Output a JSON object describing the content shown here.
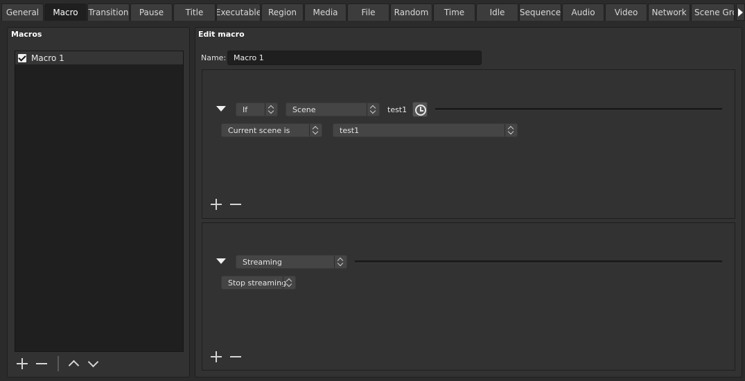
{
  "tabs": [
    {
      "label": "General"
    },
    {
      "label": "Macro",
      "active": true
    },
    {
      "label": "Transition"
    },
    {
      "label": "Pause"
    },
    {
      "label": "Title"
    },
    {
      "label": "Executable"
    },
    {
      "label": "Region"
    },
    {
      "label": "Media"
    },
    {
      "label": "File"
    },
    {
      "label": "Random"
    },
    {
      "label": "Time"
    },
    {
      "label": "Idle"
    },
    {
      "label": "Sequence"
    },
    {
      "label": "Audio"
    },
    {
      "label": "Video"
    },
    {
      "label": "Network"
    },
    {
      "label": "Scene Gro"
    }
  ],
  "macros_panel": {
    "title": "Macros",
    "items": [
      {
        "label": "Macro 1",
        "checked": true
      }
    ],
    "toolbar": [
      "plus-icon",
      "minus-icon",
      "chevron-up-icon",
      "chevron-down-icon"
    ]
  },
  "edit_panel": {
    "title": "Edit macro",
    "name_label": "Name:",
    "name_value": "Macro 1",
    "condition": {
      "logic": "If",
      "type": "Scene",
      "header_text": "test1",
      "check": "Current scene is",
      "scene": "test1"
    },
    "action": {
      "type": "Streaming",
      "action": "Stop streaming"
    }
  },
  "colors": {
    "background": "#2b2b2b",
    "panel": "#323232",
    "list": "#1f1f1f",
    "combo": "#454545",
    "active_tab": "#1f1f1f"
  }
}
